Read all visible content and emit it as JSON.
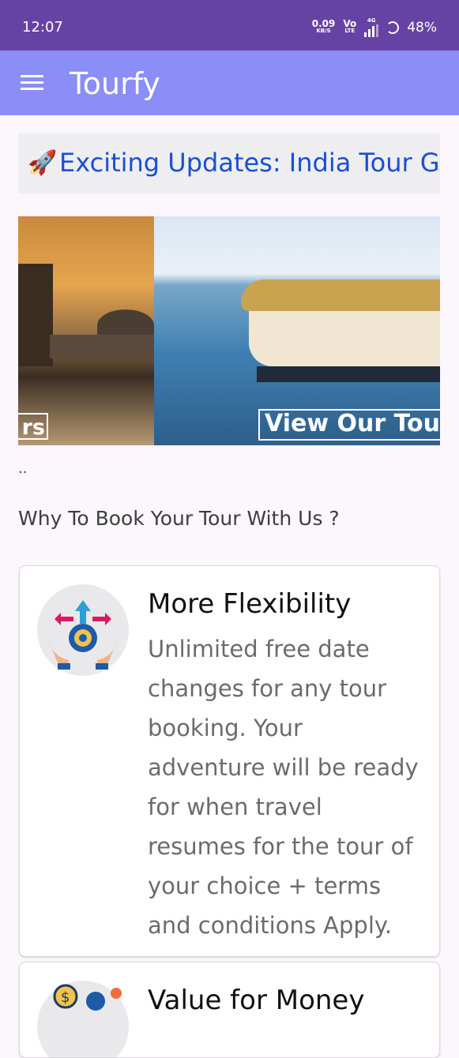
{
  "status_bar": {
    "time": "12:07",
    "net_speed": "0.09",
    "net_unit": "KB/S",
    "vo": "Vo",
    "lte": "LTE",
    "signal_tag": "4G",
    "battery": "48%"
  },
  "app_bar": {
    "title": "Tourfy",
    "menu_icon": "menu-icon"
  },
  "banner": {
    "icon": "🚀",
    "text": "Exciting Updates: India Tour G"
  },
  "carousel": {
    "slide1_label": "rs",
    "slide2_label": "View Our Tou",
    "indicator": ".."
  },
  "section_title": "Why To Book Your Tour With Us ?",
  "features": [
    {
      "title": "More Flexibility",
      "description": "Unlimited free date changes for any tour booking. Your adventure will be ready for when travel resumes for the tour of your choice + terms and conditions Apply."
    },
    {
      "title": "Value for Money",
      "description": ""
    }
  ],
  "colors": {
    "status_bar": "#6742a5",
    "app_bar": "#8a8ef6",
    "banner_text": "#1a4fd4",
    "background": "#fcf6fd"
  }
}
